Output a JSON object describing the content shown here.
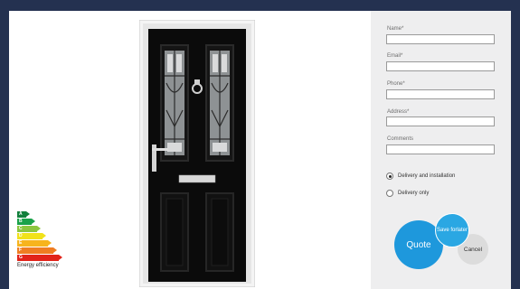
{
  "form": {
    "fields": [
      {
        "label": "Name*",
        "value": ""
      },
      {
        "label": "Email*",
        "value": ""
      },
      {
        "label": "Phone*",
        "value": ""
      },
      {
        "label": "Address*",
        "value": ""
      },
      {
        "label": "Comments",
        "value": ""
      }
    ],
    "delivery_options": [
      {
        "label": "Delivery and installation",
        "selected": true
      },
      {
        "label": "Delivery only",
        "selected": false
      }
    ],
    "buttons": {
      "quote": "Quote",
      "save_for_later": "Save for later",
      "cancel": "Cancel"
    }
  },
  "energy_rating": {
    "caption": "Energy efficiency",
    "grades": [
      {
        "letter": "A",
        "color": "#12803c"
      },
      {
        "letter": "B",
        "color": "#1aa24a"
      },
      {
        "letter": "C",
        "color": "#8cc63f"
      },
      {
        "letter": "D",
        "color": "#f1e21b"
      },
      {
        "letter": "E",
        "color": "#f7b41d"
      },
      {
        "letter": "F",
        "color": "#ef7d22"
      },
      {
        "letter": "G",
        "color": "#e2231a"
      }
    ],
    "current_grade": "C"
  },
  "colors": {
    "page_background": "#243150",
    "accent_blue": "#1e98dc"
  }
}
